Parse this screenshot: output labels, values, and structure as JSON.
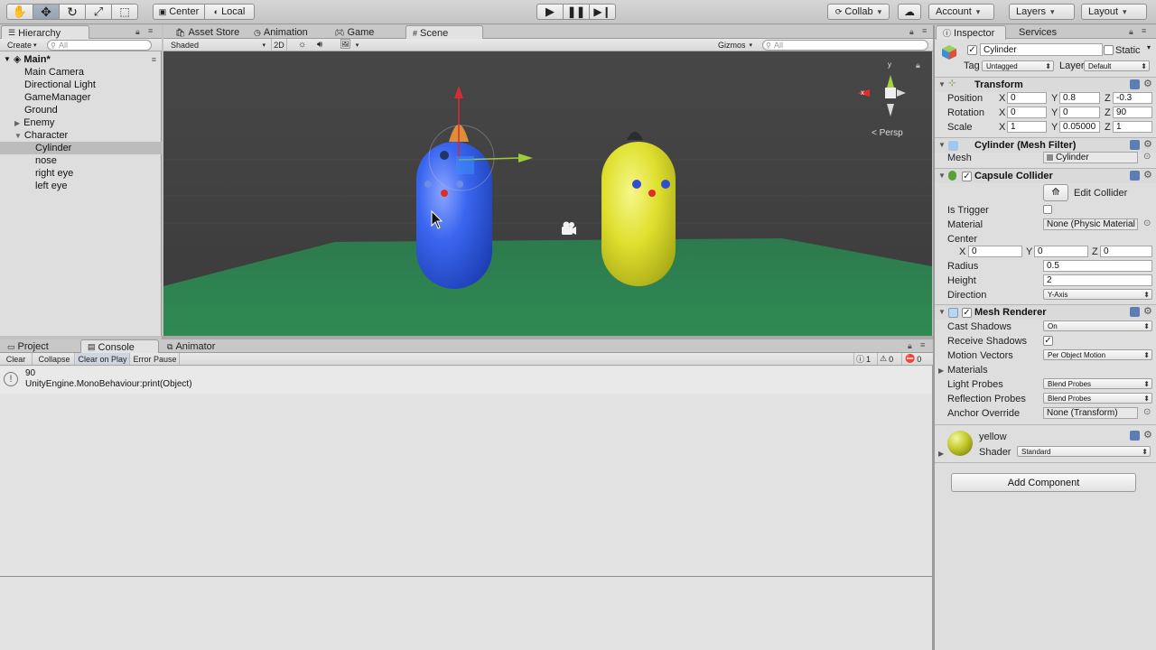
{
  "toolbar": {
    "pivot": "Center",
    "space": "Local",
    "collab": "Collab",
    "account": "Account",
    "layers": "Layers",
    "layout": "Layout"
  },
  "hierarchy": {
    "tab": "Hierarchy",
    "create": "Create",
    "search_placeholder": "All",
    "scene": "Main*",
    "items": [
      {
        "label": "Main Camera"
      },
      {
        "label": "Directional Light"
      },
      {
        "label": "GameManager"
      },
      {
        "label": "Ground"
      },
      {
        "label": "Enemy"
      },
      {
        "label": "Character"
      },
      {
        "label": "Cylinder"
      },
      {
        "label": "nose"
      },
      {
        "label": "right eye"
      },
      {
        "label": "left eye"
      }
    ]
  },
  "scene_tabs": {
    "asset_store": "Asset Store",
    "animation": "Animation",
    "game": "Game",
    "scene": "Scene"
  },
  "scene_bar": {
    "shading": "Shaded",
    "mode_2d": "2D",
    "gizmos": "Gizmos",
    "search_placeholder": "All"
  },
  "scene_view": {
    "persp": "< Persp",
    "axis_x": "x",
    "axis_y": "y"
  },
  "bottom_tabs": {
    "project": "Project",
    "console": "Console",
    "animator": "Animator"
  },
  "console_bar": {
    "clear": "Clear",
    "collapse": "Collapse",
    "clear_on_play": "Clear on Play",
    "error_pause": "Error Pause",
    "info_count": "1",
    "warn_count": "0",
    "error_count": "0"
  },
  "console_log": {
    "line1": "90",
    "line2": "UnityEngine.MonoBehaviour:print(Object)"
  },
  "inspector": {
    "tab": "Inspector",
    "services": "Services",
    "name": "Cylinder",
    "static": "Static",
    "tag_label": "Tag",
    "tag_value": "Untagged",
    "layer_label": "Layer",
    "layer_value": "Default",
    "transform": {
      "title": "Transform",
      "position_label": "Position",
      "rotation_label": "Rotation",
      "scale_label": "Scale",
      "position": {
        "x": "0",
        "y": "0.8",
        "z": "-0.3"
      },
      "rotation": {
        "x": "0",
        "y": "0",
        "z": "90"
      },
      "scale": {
        "x": "1",
        "y": "0.05000",
        "z": "1"
      }
    },
    "mesh_filter": {
      "title": "Cylinder (Mesh Filter)",
      "mesh_label": "Mesh",
      "mesh_value": "Cylinder"
    },
    "capsule_collider": {
      "title": "Capsule Collider",
      "edit_collider": "Edit Collider",
      "is_trigger": "Is Trigger",
      "material_label": "Material",
      "material_value": "None (Physic Material",
      "center_label": "Center",
      "center": {
        "x": "0",
        "y": "0",
        "z": "0"
      },
      "radius_label": "Radius",
      "radius": "0.5",
      "height_label": "Height",
      "height": "2",
      "direction_label": "Direction",
      "direction": "Y-Axis"
    },
    "mesh_renderer": {
      "title": "Mesh Renderer",
      "cast_shadows_label": "Cast Shadows",
      "cast_shadows": "On",
      "receive_shadows_label": "Receive Shadows",
      "motion_vectors_label": "Motion Vectors",
      "motion_vectors": "Per Object Motion",
      "materials_label": "Materials",
      "light_probes_label": "Light Probes",
      "light_probes": "Blend Probes",
      "reflection_probes_label": "Reflection Probes",
      "reflection_probes": "Blend Probes",
      "anchor_override_label": "Anchor Override",
      "anchor_override": "None (Transform)"
    },
    "material": {
      "name": "yellow",
      "shader_label": "Shader",
      "shader": "Standard"
    },
    "add_component": "Add Component"
  },
  "colors": {
    "selection": "#bcbcbc",
    "ground": "#2f7d50",
    "blue_character": "#2f5ff0",
    "yellow_character": "#dde030"
  }
}
